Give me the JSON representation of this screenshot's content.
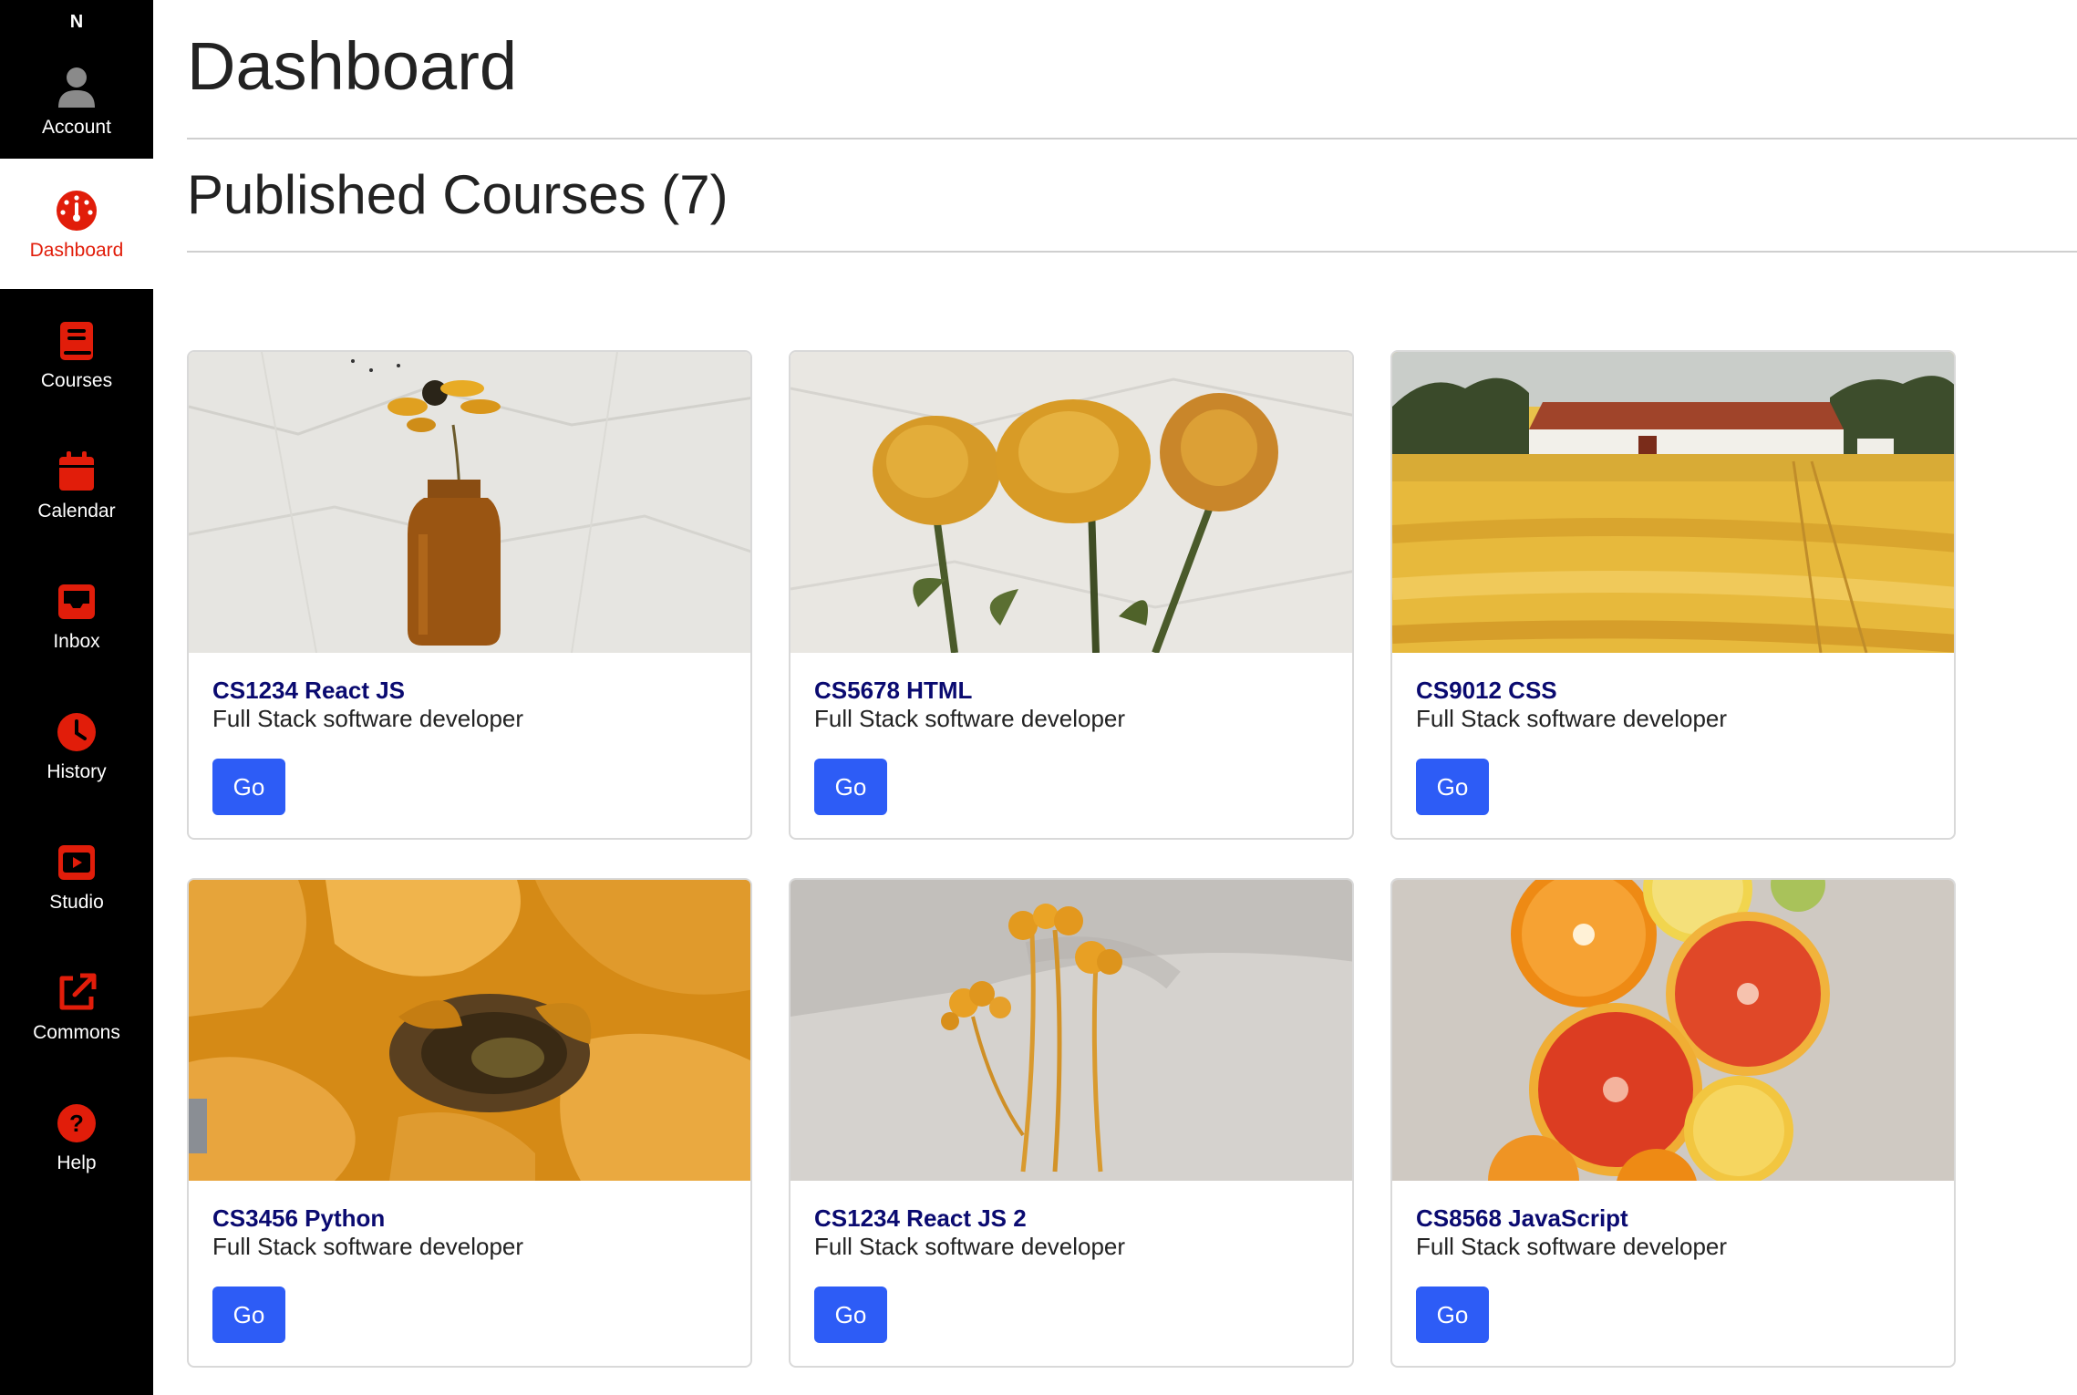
{
  "sidebar": {
    "brand": "N",
    "accent_color": "#e11d0a",
    "items": [
      {
        "label": "Account",
        "icon": "user-icon",
        "active": false
      },
      {
        "label": "Dashboard",
        "icon": "dashboard-gauge-icon",
        "active": true
      },
      {
        "label": "Courses",
        "icon": "book-icon",
        "active": false
      },
      {
        "label": "Calendar",
        "icon": "calendar-icon",
        "active": false
      },
      {
        "label": "Inbox",
        "icon": "inbox-icon",
        "active": false
      },
      {
        "label": "History",
        "icon": "clock-icon",
        "active": false
      },
      {
        "label": "Studio",
        "icon": "play-screen-icon",
        "active": false
      },
      {
        "label": "Commons",
        "icon": "external-link-icon",
        "active": false
      },
      {
        "label": "Help",
        "icon": "help-icon",
        "active": false
      }
    ]
  },
  "main": {
    "title": "Dashboard",
    "section_title": "Published Courses (7)"
  },
  "courses": [
    {
      "title": "CS1234 React JS",
      "subtitle": "Full Stack software developer",
      "button": "Go",
      "image": "flower-in-amber-vase"
    },
    {
      "title": "CS5678 HTML",
      "subtitle": "Full Stack software developer",
      "button": "Go",
      "image": "dried-yellow-roses"
    },
    {
      "title": "CS9012 CSS",
      "subtitle": "Full Stack software developer",
      "button": "Go",
      "image": "yellow-field-with-barn"
    },
    {
      "title": "CS3456 Python",
      "subtitle": "Full Stack software developer",
      "button": "Go",
      "image": "dried-sunflower-closeup"
    },
    {
      "title": "CS1234 React JS 2",
      "subtitle": "Full Stack software developer",
      "button": "Go",
      "image": "dried-yellow-wildflowers"
    },
    {
      "title": "CS8568 JavaScript",
      "subtitle": "Full Stack software developer",
      "button": "Go",
      "image": "sliced-citrus-fruits"
    }
  ]
}
